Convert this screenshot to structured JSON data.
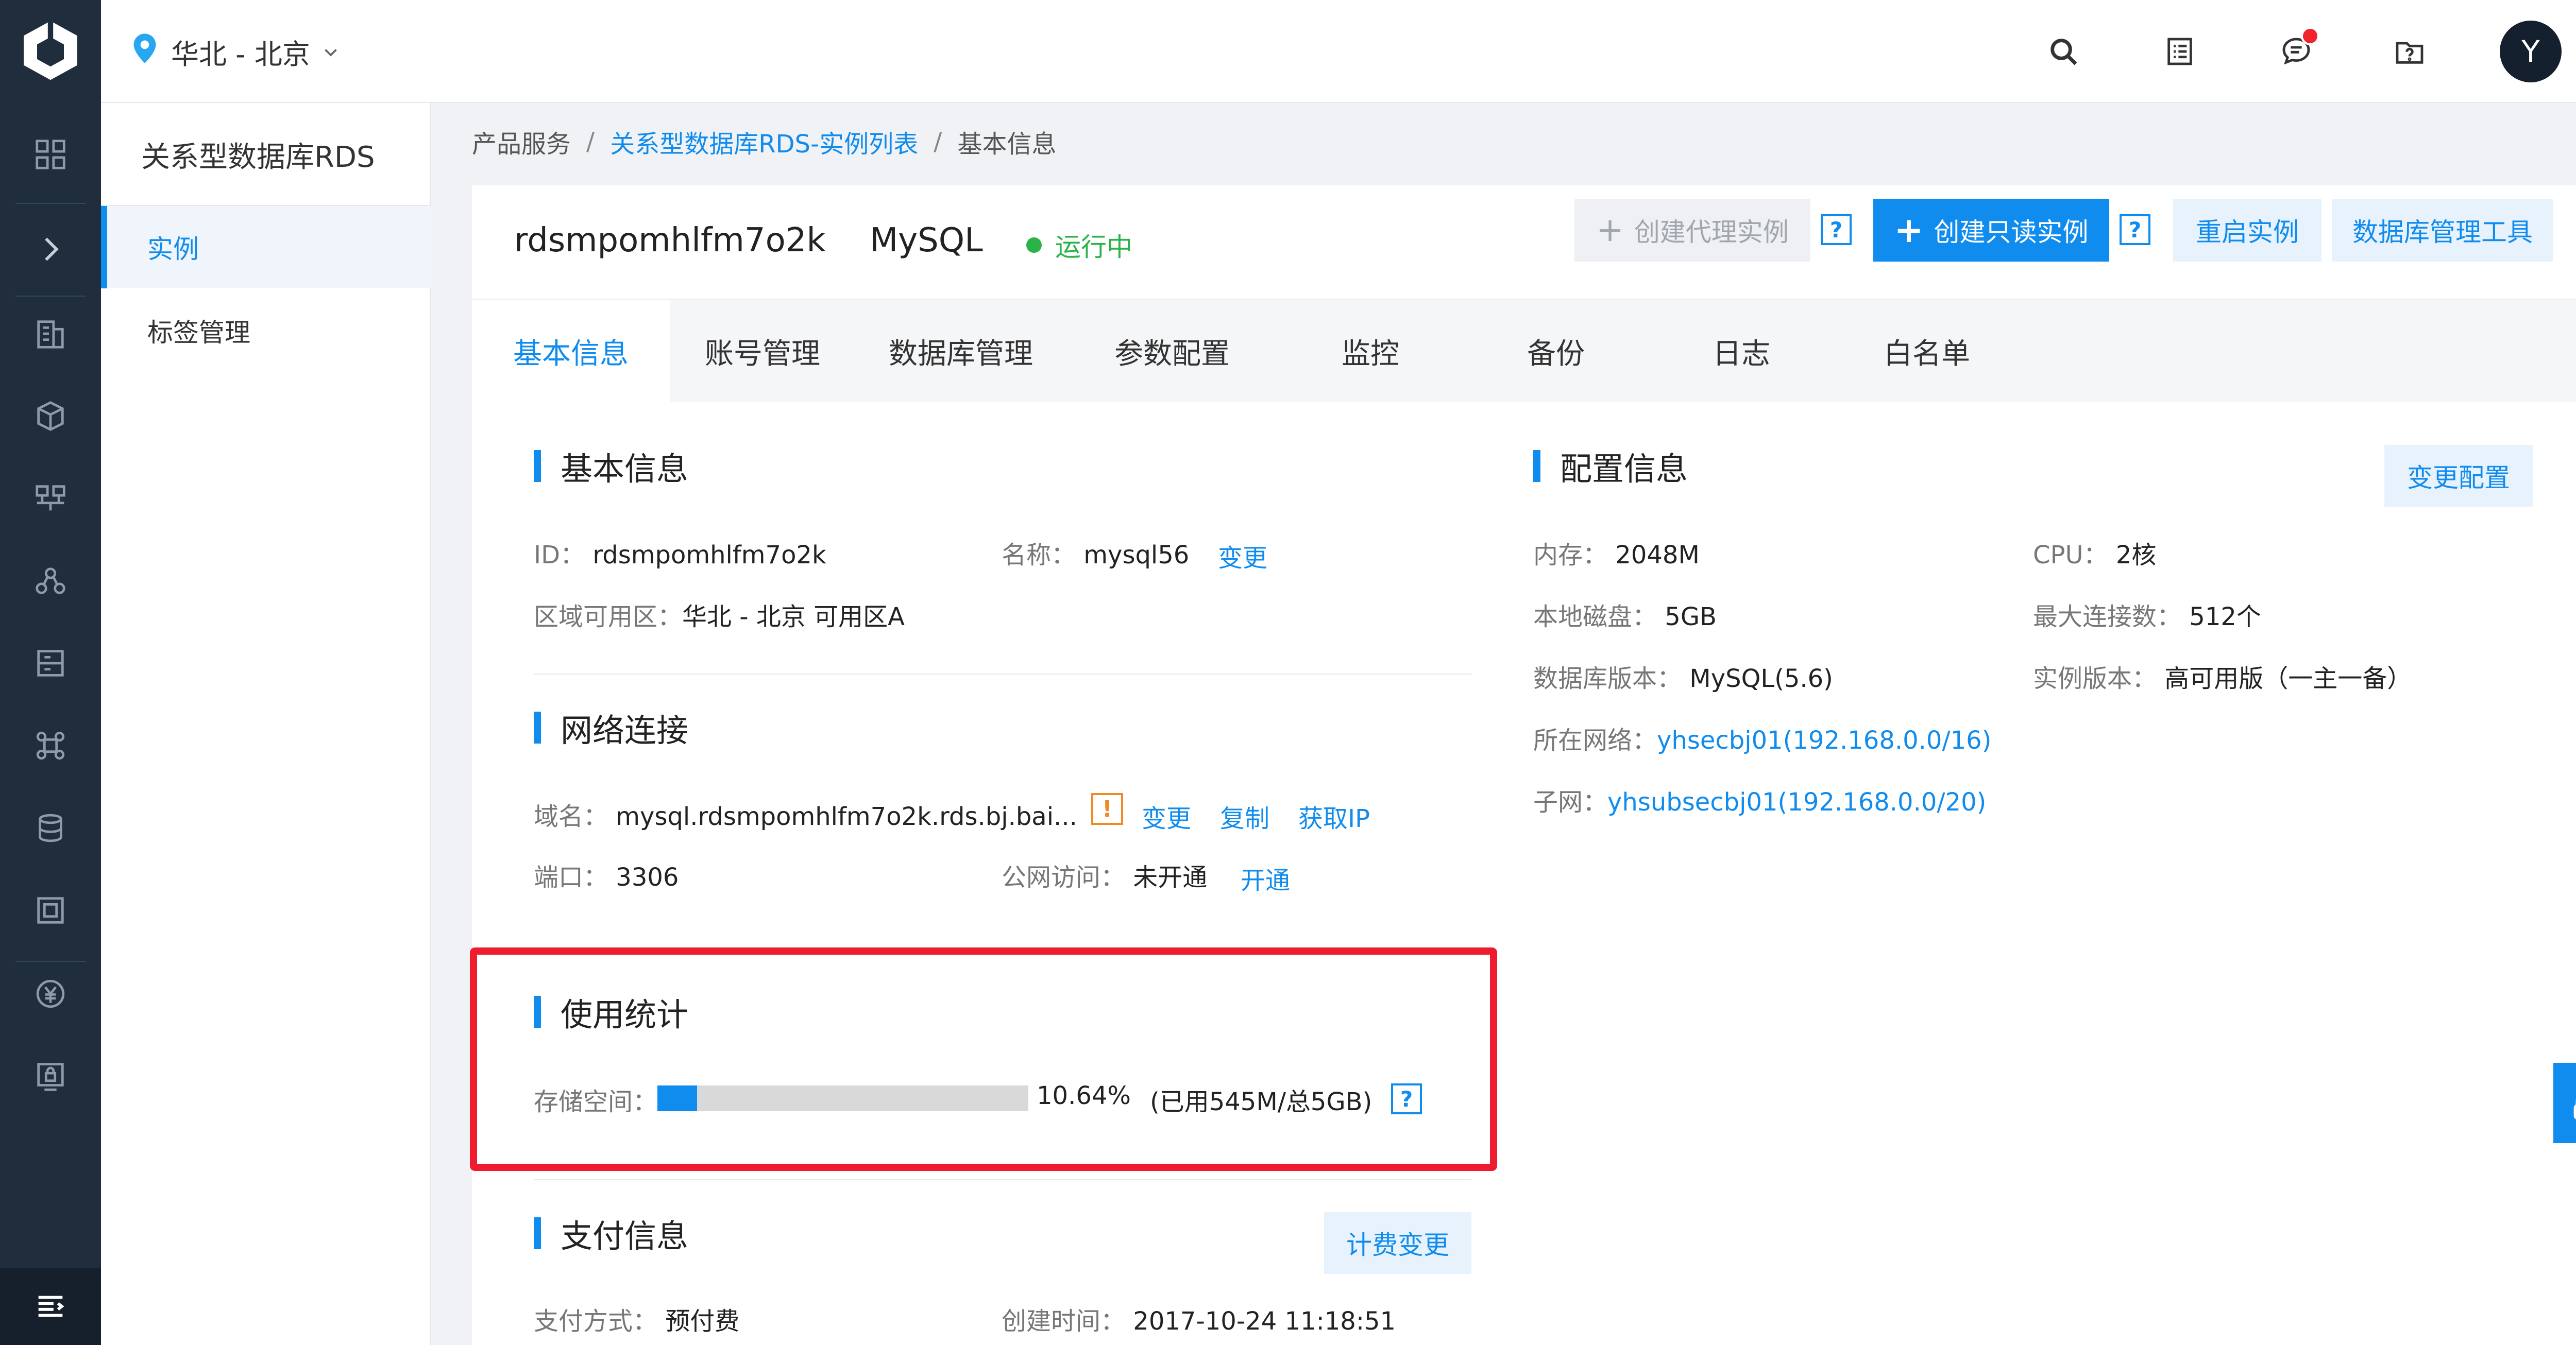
{
  "topbar": {
    "region": "华北 - 北京",
    "avatar_letter": "Y"
  },
  "subnav": {
    "title": "关系型数据库RDS",
    "items": [
      {
        "label": "实例"
      },
      {
        "label": "标签管理"
      }
    ]
  },
  "breadcrumb": {
    "root": "产品服务",
    "list": "关系型数据库RDS-实例列表",
    "current": "基本信息"
  },
  "instance": {
    "id": "rdsmpomhlfm7o2k",
    "engine": "MySQL",
    "status": "运行中"
  },
  "actions": {
    "create_proxy": "创建代理实例",
    "create_readonly": "创建只读实例",
    "restart": "重启实例",
    "db_tool": "数据库管理工具",
    "help": "?"
  },
  "tabs": [
    {
      "label": "基本信息"
    },
    {
      "label": "账号管理"
    },
    {
      "label": "数据库管理"
    },
    {
      "label": "参数配置"
    },
    {
      "label": "监控"
    },
    {
      "label": "备份"
    },
    {
      "label": "日志"
    },
    {
      "label": "白名单"
    }
  ],
  "basic": {
    "title": "基本信息",
    "id_label": "ID：",
    "id_value": "rdsmpomhlfm7o2k",
    "name_label": "名称：",
    "name_value": "mysql56",
    "change": "变更",
    "zone_label": "区域可用区：",
    "zone_value": "华北 - 北京 可用区A"
  },
  "network": {
    "title": "网络连接",
    "domain_label": "域名：",
    "domain_value": "mysql.rdsmpomhlfm7o2k.rds.bj.bai...",
    "warn": "!",
    "change": "变更",
    "copy": "复制",
    "get_ip": "获取IP",
    "port_label": "端口：",
    "port_value": "3306",
    "public_label": "公网访问：",
    "public_value": "未开通",
    "enable": "开通"
  },
  "usage": {
    "title": "使用统计",
    "storage_label": "存储空间：",
    "percent_text": "10.64%",
    "percent": 10.64,
    "detail": "(已用545M/总5GB)"
  },
  "payment": {
    "title": "支付信息",
    "change_billing": "计费变更",
    "method_label": "支付方式：",
    "method_value": "预付费",
    "created_label": "创建时间：",
    "created_value": "2017-10-24 11:18:51"
  },
  "config": {
    "title": "配置信息",
    "change_config": "变更配置",
    "memory_label": "内存：",
    "memory_value": "2048M",
    "cpu_label": "CPU：",
    "cpu_value": "2核",
    "disk_label": "本地磁盘：",
    "disk_value": "5GB",
    "maxconn_label": "最大连接数：",
    "maxconn_value": "512个",
    "dbver_label": "数据库版本：",
    "dbver_value": "MySQL(5.6)",
    "instver_label": "实例版本：",
    "instver_value": "高可用版（一主一备）",
    "vpc_label": "所在网络：",
    "vpc_value": "yhsecbj01(192.168.0.0/16)",
    "subnet_label": "子网：",
    "subnet_value": "yhsubsecbj01(192.168.0.0/20)"
  },
  "colors": {
    "accent": "#108cee",
    "rail": "#1f2d3d",
    "running": "#2bb34a",
    "highlight": "#ee1c2e"
  }
}
